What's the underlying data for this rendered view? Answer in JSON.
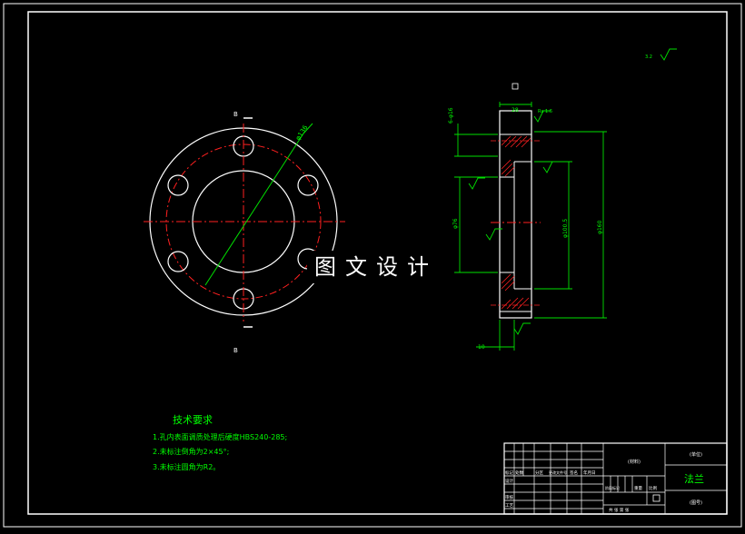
{
  "drawing": {
    "colors": {
      "background": "#000000",
      "outline": "#ffffff",
      "centerline": "#ff2020",
      "dimension": "#00e000",
      "text_green": "#00ff00",
      "text_white": "#ffffff"
    },
    "front_view": {
      "section_mark_top": "B",
      "section_mark_bottom": "B",
      "pcd_dim": "φ136"
    },
    "side_view": {
      "dims": {
        "holes": "6-φ16",
        "width": "28",
        "inner": "φ100.5",
        "outer": "φ160",
        "bore": "φ76",
        "bottom_width": "10"
      },
      "roughness_top": "Ra 1.6",
      "general_roughness": "3.2"
    },
    "watermark": "图文设计",
    "tech_requirements": {
      "title": "技术要求",
      "items": [
        "1.孔内表面调质处理后硬度HBS240-285;",
        "2.未标注倒角为2×45°;",
        "3.未标注圆角为R2。"
      ]
    },
    "title_block": {
      "material": "(材料)",
      "company": "(单位)",
      "part_name": "法兰",
      "drawing_no": "(图号)",
      "stage_labels": [
        "标记",
        "处数",
        "分区",
        "更改文件号",
        "签名",
        "年月日"
      ],
      "row_labels": [
        "设计",
        "审核",
        "工艺"
      ],
      "bottom_labels": [
        "共 张 第 张"
      ],
      "right_labels": [
        "阶段标记",
        "重量",
        "比例"
      ]
    }
  }
}
